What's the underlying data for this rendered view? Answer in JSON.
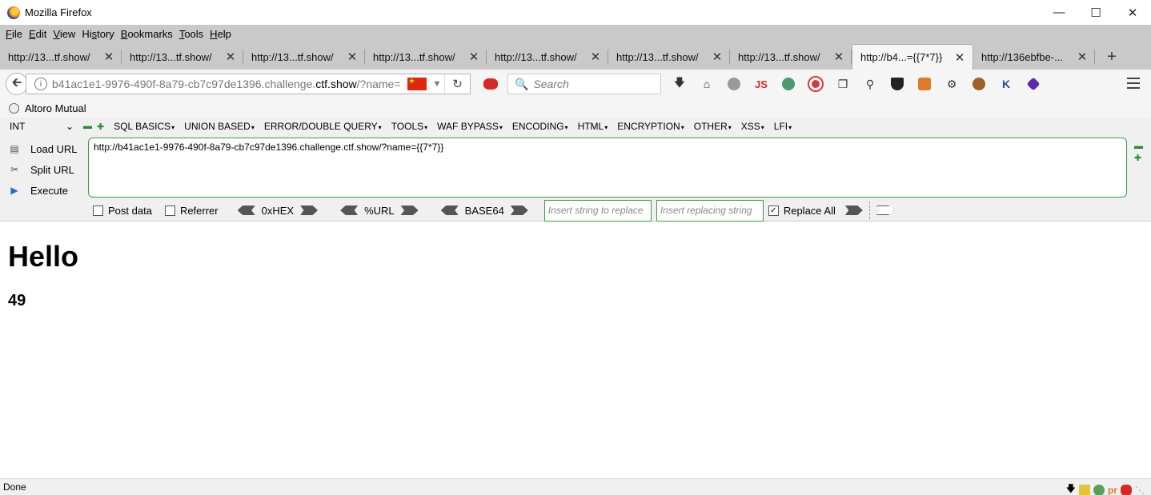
{
  "window": {
    "title": "Mozilla Firefox"
  },
  "menu": [
    "File",
    "Edit",
    "View",
    "History",
    "Bookmarks",
    "Tools",
    "Help"
  ],
  "menu_access_keys": [
    "F",
    "E",
    "V",
    "s",
    "B",
    "T",
    "H"
  ],
  "tabs": [
    {
      "label": "http://13...tf.show/"
    },
    {
      "label": "http://13...tf.show/"
    },
    {
      "label": "http://13...tf.show/"
    },
    {
      "label": "http://13...tf.show/"
    },
    {
      "label": "http://13...tf.show/"
    },
    {
      "label": "http://13...tf.show/"
    },
    {
      "label": "http://13...tf.show/"
    },
    {
      "label": "http://b4...={{7*7}}"
    },
    {
      "label": "http://136ebfbe-..."
    }
  ],
  "active_tab_index": 7,
  "nav": {
    "url_prefix": "b41ac1e1-9976-490f-8a79-cb7c97de1396.challenge.",
    "url_domain": "ctf.show",
    "url_suffix": "/?name=",
    "search_placeholder": "Search",
    "js_label": "JS"
  },
  "bookmarks": [
    {
      "label": "Altoro Mutual"
    }
  ],
  "hackbar": {
    "select_value": "INT",
    "menus": [
      "SQL BASICS",
      "UNION BASED",
      "ERROR/DOUBLE QUERY",
      "TOOLS",
      "WAF BYPASS",
      "ENCODING",
      "HTML",
      "ENCRYPTION",
      "OTHER",
      "XSS",
      "LFI"
    ],
    "load_url": "Load URL",
    "split_url": "Split URL",
    "execute": "Execute",
    "url_text": "http://b41ac1e1-9976-490f-8a79-cb7c97de1396.challenge.ctf.show/?name={{7*7}}",
    "post_data": "Post data",
    "referrer": "Referrer",
    "hex": "0xHEX",
    "urlenc": "%URL",
    "base64": "BASE64",
    "replace_placeholder": "Insert string to replace",
    "replacing_placeholder": "Insert replacing string",
    "replace_all": "Replace All",
    "replace_all_checked": true
  },
  "page": {
    "heading": "Hello",
    "result": "49"
  },
  "status": {
    "text": "Done"
  },
  "colors": {
    "hackbar_border": "#3c9a3c",
    "chrome_gray": "#c9c9c9"
  }
}
